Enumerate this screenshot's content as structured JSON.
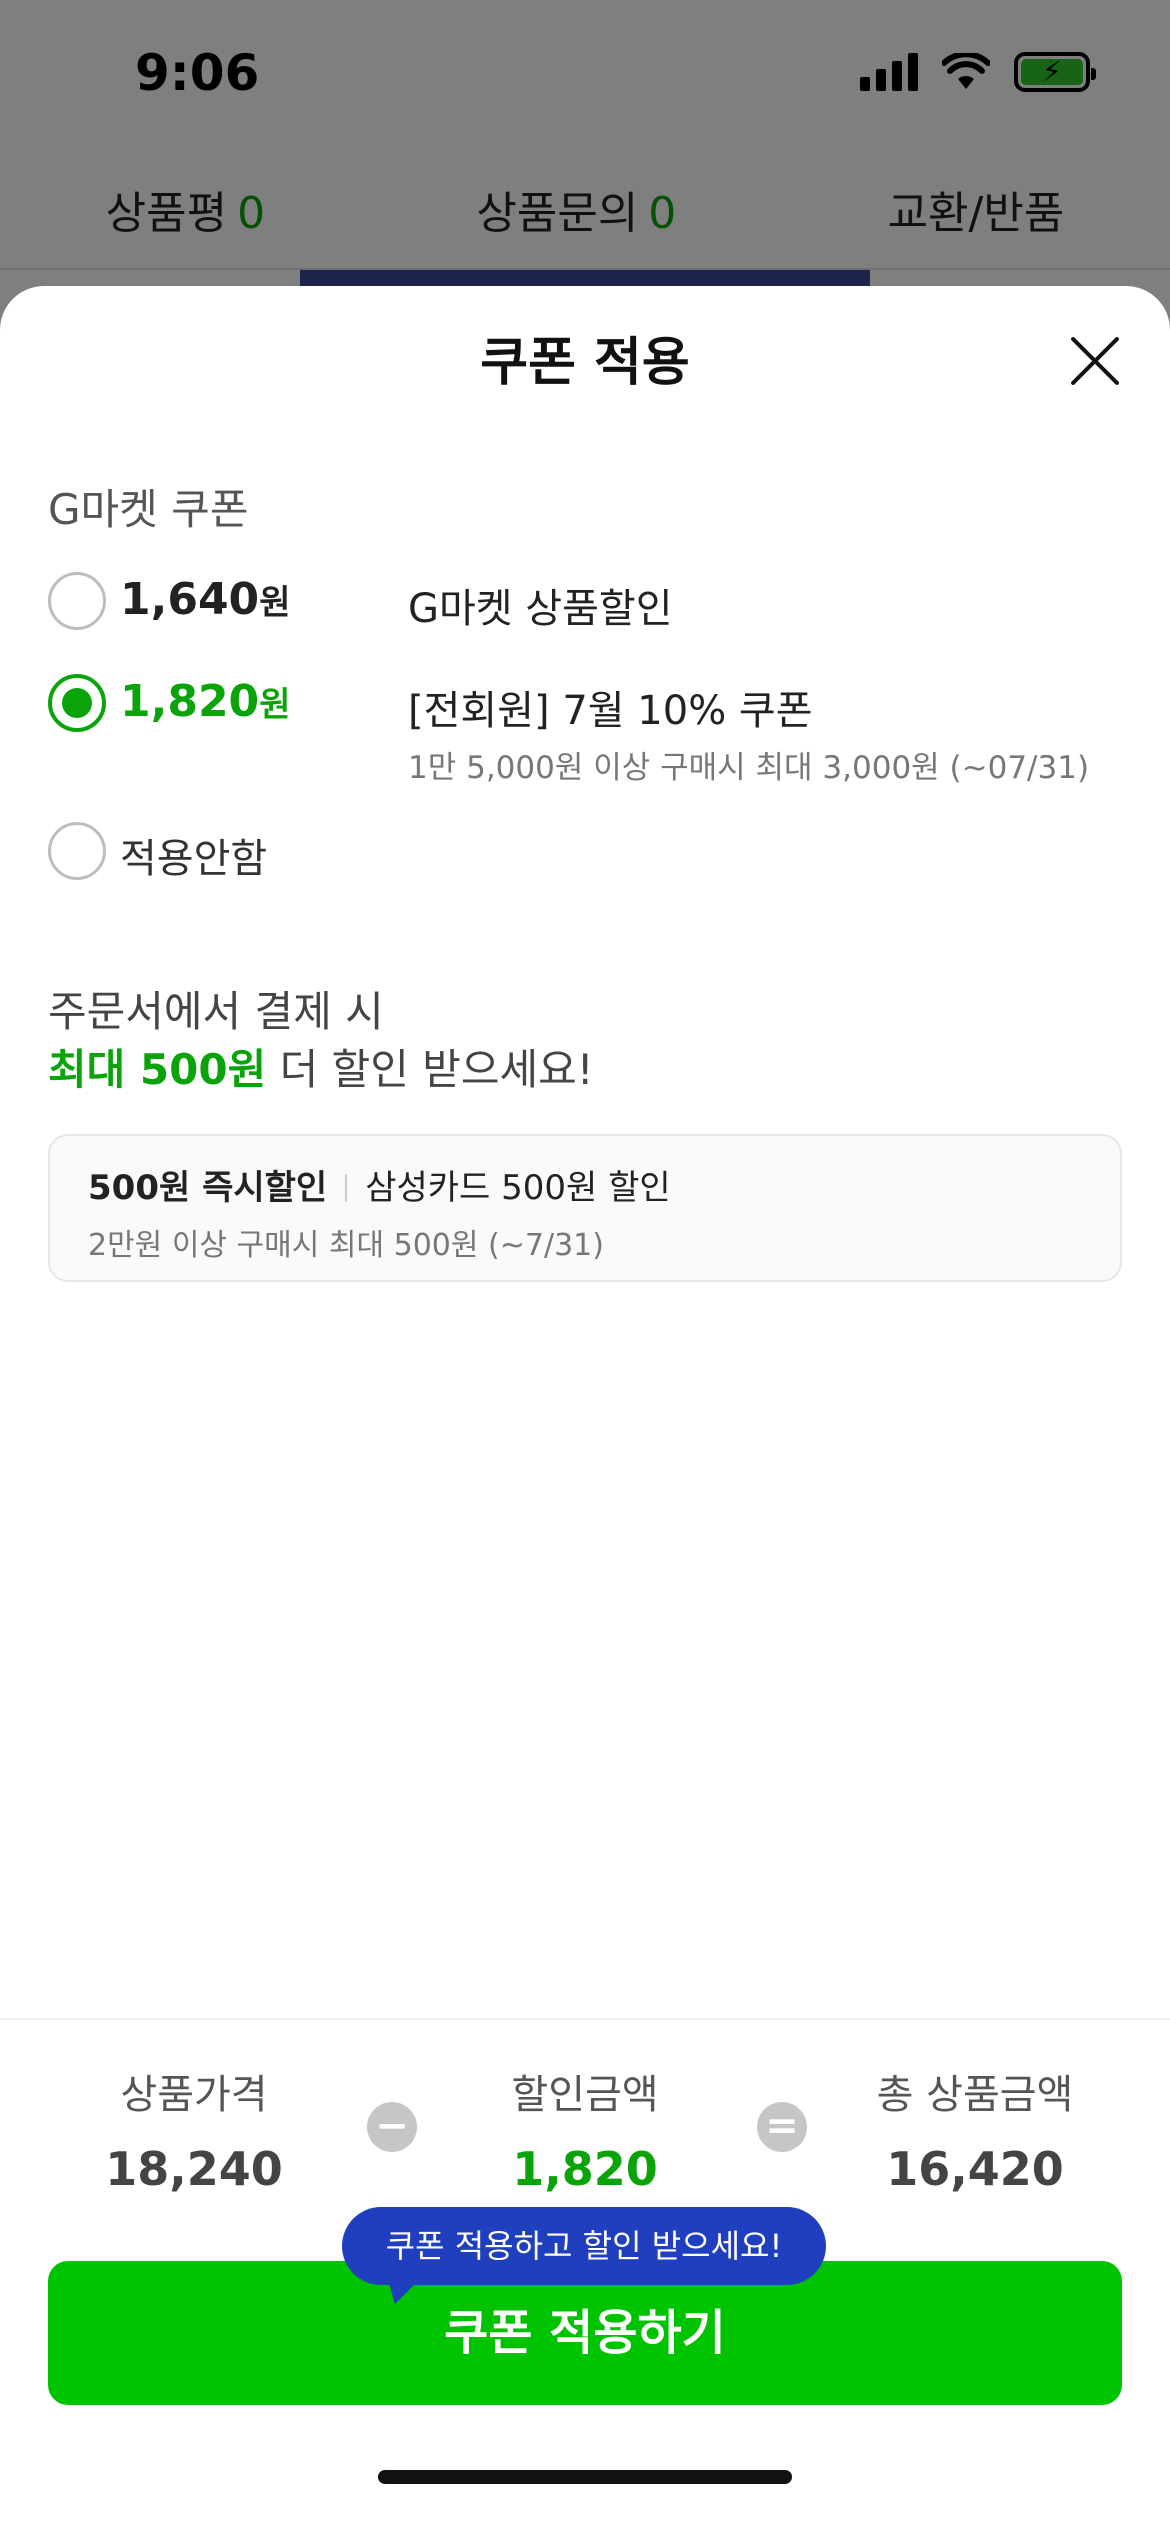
{
  "status_bar": {
    "time": "9:06"
  },
  "background_tabs": [
    {
      "label": "상품평",
      "count": "0"
    },
    {
      "label": "상품문의",
      "count": "0"
    },
    {
      "label": "교환/반품",
      "count": ""
    }
  ],
  "sheet": {
    "title": "쿠폰 적용",
    "section_label": "G마켓 쿠폰",
    "coupons": [
      {
        "amount": "1,640",
        "unit": "원",
        "name": "G마켓 상품할인",
        "desc": "",
        "selected": false
      },
      {
        "amount": "1,820",
        "unit": "원",
        "name": "[전회원] 7월 10% 쿠폰",
        "desc": "1만 5,000원 이상 구매시 최대 3,000원 (~07/31)",
        "selected": true
      }
    ],
    "not_apply_label": "적용안함",
    "promo": {
      "line1": "주문서에서 결제 시",
      "highlight": "최대 500원",
      "line2_rest": " 더 할인 받으세요!"
    },
    "card_offer": {
      "title_strong": "500원 즉시할인",
      "title_rest": "삼성카드 500원 할인",
      "condition": "2만원 이상 구매시 최대 500원 (~7/31)"
    }
  },
  "summary": {
    "price_label": "상품가격",
    "price_value": "18,240",
    "discount_label": "할인금액",
    "discount_value": "1,820",
    "total_label": "총 상품금액",
    "total_value": "16,420",
    "minus_symbol": "−",
    "equals_symbol": "="
  },
  "tooltip_text": "쿠폰 적용하고 할인 받으세요!",
  "apply_button_label": "쿠폰 적용하기",
  "colors": {
    "accent": "#00c300",
    "green_text": "#0aa40a",
    "tooltip_bg": "#1f3fbf"
  }
}
